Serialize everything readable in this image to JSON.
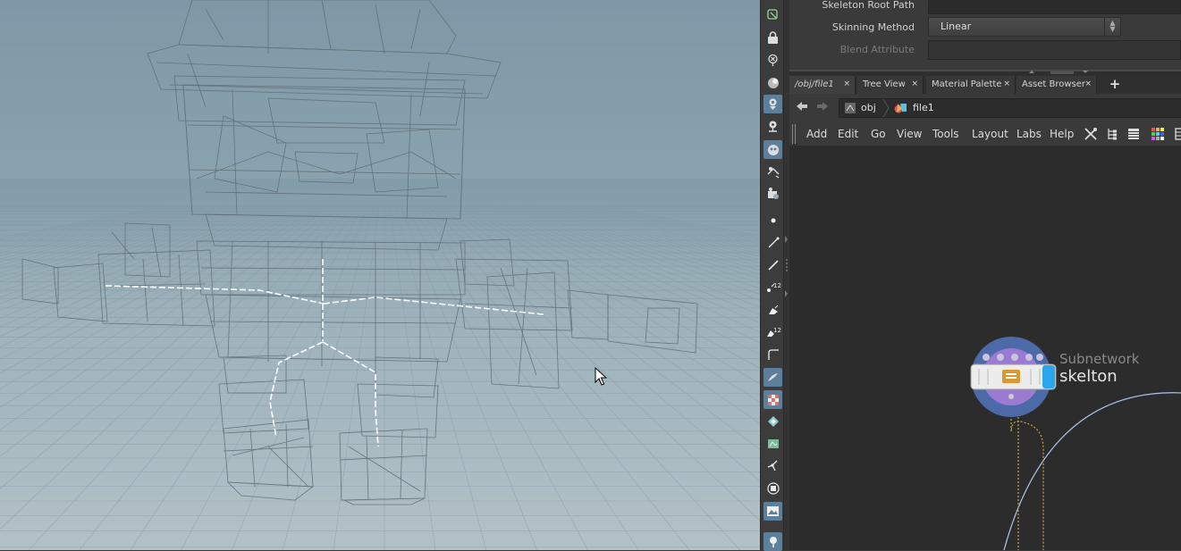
{
  "parameters": {
    "skeleton_root_path_label": "Skeleton Root Path",
    "skinning_method_label": "Skinning Method",
    "skinning_method_value": "Linear",
    "blend_attribute_label": "Blend Attribute"
  },
  "tabs": [
    {
      "label": "/obj/file1",
      "active": true
    },
    {
      "label": "Tree View",
      "active": false
    },
    {
      "label": "Material Palette",
      "active": false
    },
    {
      "label": "Asset Browser",
      "active": false
    }
  ],
  "tab_add_label": "+",
  "tab_close_glyph": "×",
  "path": {
    "crumb1": "obj",
    "crumb2": "file1"
  },
  "menu": [
    "Add",
    "Edit",
    "Go",
    "View",
    "Tools",
    "Layout",
    "Labs",
    "Help"
  ],
  "node": {
    "type": "Subnetwork",
    "name": "skelton"
  },
  "toolstrip_icons": [
    "select-icon",
    "lock-icon",
    "pin-icon",
    "snap-icon",
    "camera-icon",
    "light-icon",
    "bone-icon",
    "render-icon",
    "view-icon",
    "point-icon",
    "edge-icon",
    "pen-icon",
    "number-icon",
    "brush-icon",
    "brush-number-icon",
    "curve-icon",
    "paint-icon",
    "checker-icon",
    "layer-icon",
    "texture-icon",
    "skeleton-icon",
    "bar-icon",
    "image-icon",
    "pin-bottom-icon"
  ],
  "colors": {
    "accent_blue": "#5e7f99",
    "node_purple": "#9a7bd1",
    "node_blue": "#5272b0",
    "wire_yellow": "#c9a64a",
    "selection_blue": "#aac4ea"
  }
}
